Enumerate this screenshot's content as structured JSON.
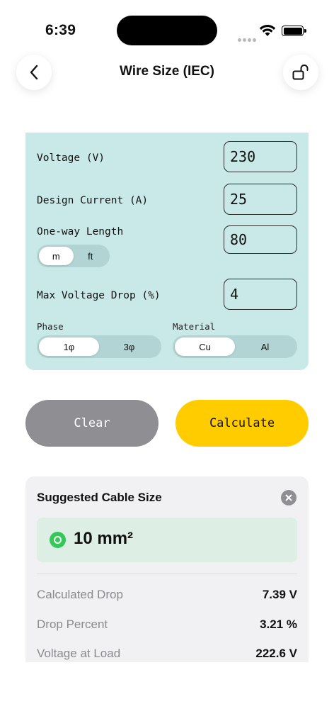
{
  "status_bar": {
    "time": "6:39"
  },
  "header": {
    "title": "Wire Size (IEC)"
  },
  "form": {
    "voltage": {
      "label": "Voltage (V)",
      "value": "230"
    },
    "current": {
      "label": "Design Current (A)",
      "value": "25"
    },
    "length": {
      "label": "One-way Length",
      "value": "80",
      "units": [
        "m",
        "ft"
      ],
      "selected_unit": "m"
    },
    "max_drop": {
      "label": "Max Voltage Drop (%)",
      "value": "4"
    },
    "phase": {
      "label": "Phase",
      "options": [
        "1φ",
        "3φ"
      ],
      "selected": "1φ"
    },
    "material": {
      "label": "Material",
      "options": [
        "Cu",
        "Al"
      ],
      "selected": "Cu"
    }
  },
  "actions": {
    "clear_label": "Clear",
    "calculate_label": "Calculate"
  },
  "result": {
    "title": "Suggested Cable Size",
    "cable_size": "10 mm²",
    "status_color": "#34c759",
    "rows": [
      {
        "label": "Calculated Drop",
        "value": "7.39 V"
      },
      {
        "label": "Drop Percent",
        "value": "3.21 %"
      },
      {
        "label": "Voltage at Load",
        "value": "222.6 V"
      }
    ]
  },
  "colors": {
    "form_bg": "#c9e9e8",
    "calculate": "#ffcc00",
    "clear": "#8e8e93",
    "result_box": "#ddeee4"
  }
}
